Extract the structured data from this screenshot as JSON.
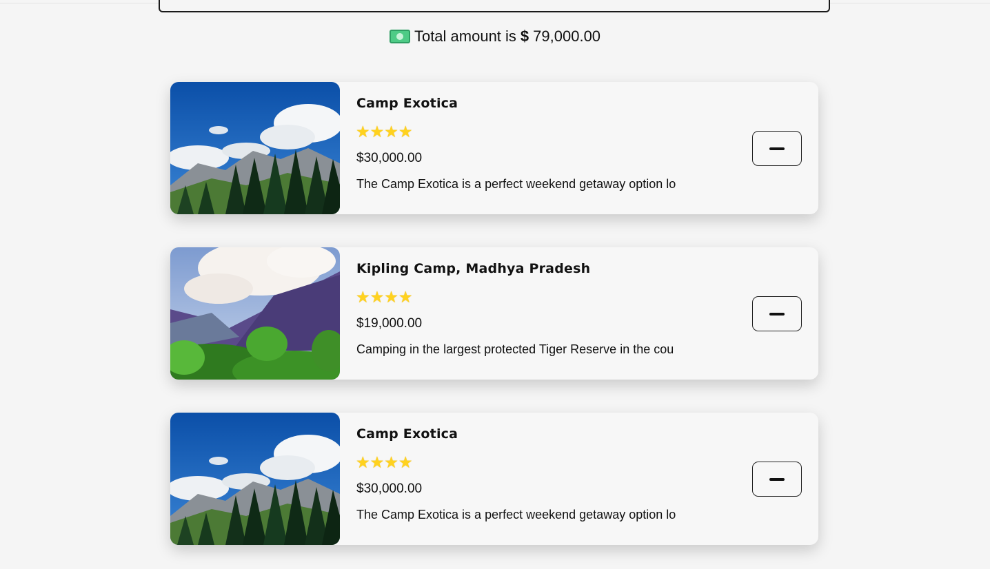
{
  "total": {
    "prefix": "Total amount is",
    "currency": "$",
    "amount": "79,000.00",
    "icon": "money-icon"
  },
  "cart_items": [
    {
      "title": "Camp Exotica",
      "rating": 4,
      "stars": "★★★★",
      "price": "$30,000.00",
      "description": "The Camp Exotica is a perfect weekend getaway option lo",
      "image": "mountain-forest-photo"
    },
    {
      "title": "Kipling Camp, Madhya Pradesh",
      "rating": 4,
      "stars": "★★★★",
      "price": "$19,000.00",
      "description": "Camping in the largest protected Tiger Reserve in the cou",
      "image": "mountain-cliffs-photo"
    },
    {
      "title": "Camp Exotica",
      "rating": 4,
      "stars": "★★★★",
      "price": "$30,000.00",
      "description": "The Camp Exotica is a perfect weekend getaway option lo",
      "image": "mountain-forest-photo"
    }
  ],
  "colors": {
    "star": "#ffd21f",
    "money": "#4ecb86",
    "background": "#f5f5f5"
  }
}
